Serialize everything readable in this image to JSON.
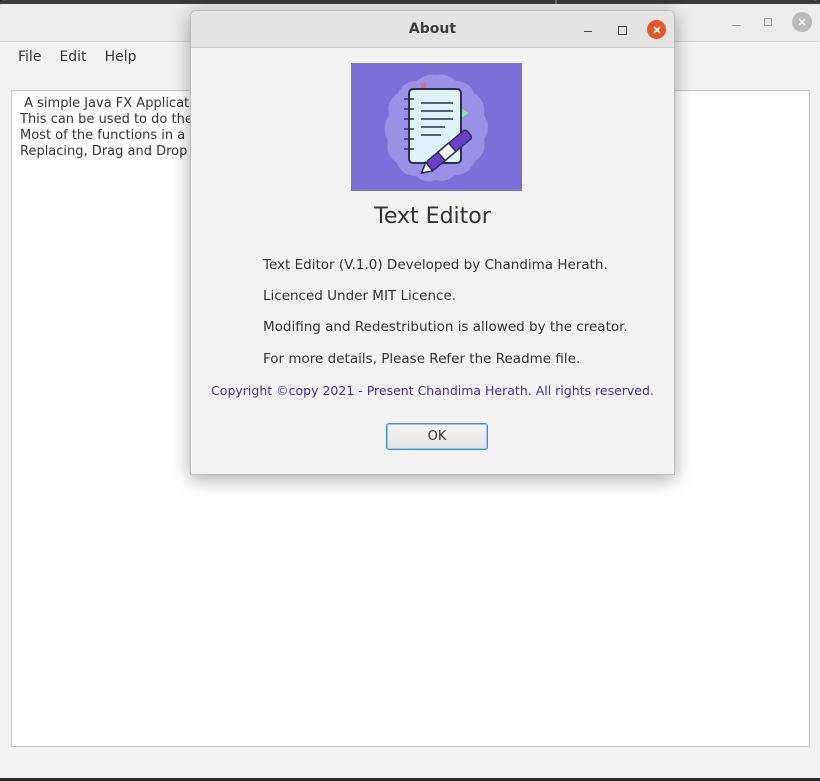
{
  "main": {
    "menu": [
      "File",
      "Edit",
      "Help"
    ],
    "text_lines": [
      " A simple Java FX Applicati                                                                                 ",
      "This can be used to do the                                                                                   cing texts.",
      "Most of the functions in a ",
      "Replacing, Drag and Drop "
    ]
  },
  "dialog": {
    "title": "About",
    "app_name": "Text Editor",
    "lines": [
      "Text Editor (V.1.0) Developed by Chandima Herath.",
      "Licenced Under MIT Licence.",
      "Modifing and Redestribution is allowed by the creator.",
      "For more details, Please Refer the Readme file."
    ],
    "copyright": "Copyright ©copy 2021 - Present Chandima Herath. All rights reserved.",
    "ok_label": "OK",
    "logo_icon": "notebook-pen-icon",
    "accent_color": "#7b6fd8",
    "close_color": "#e95420"
  }
}
